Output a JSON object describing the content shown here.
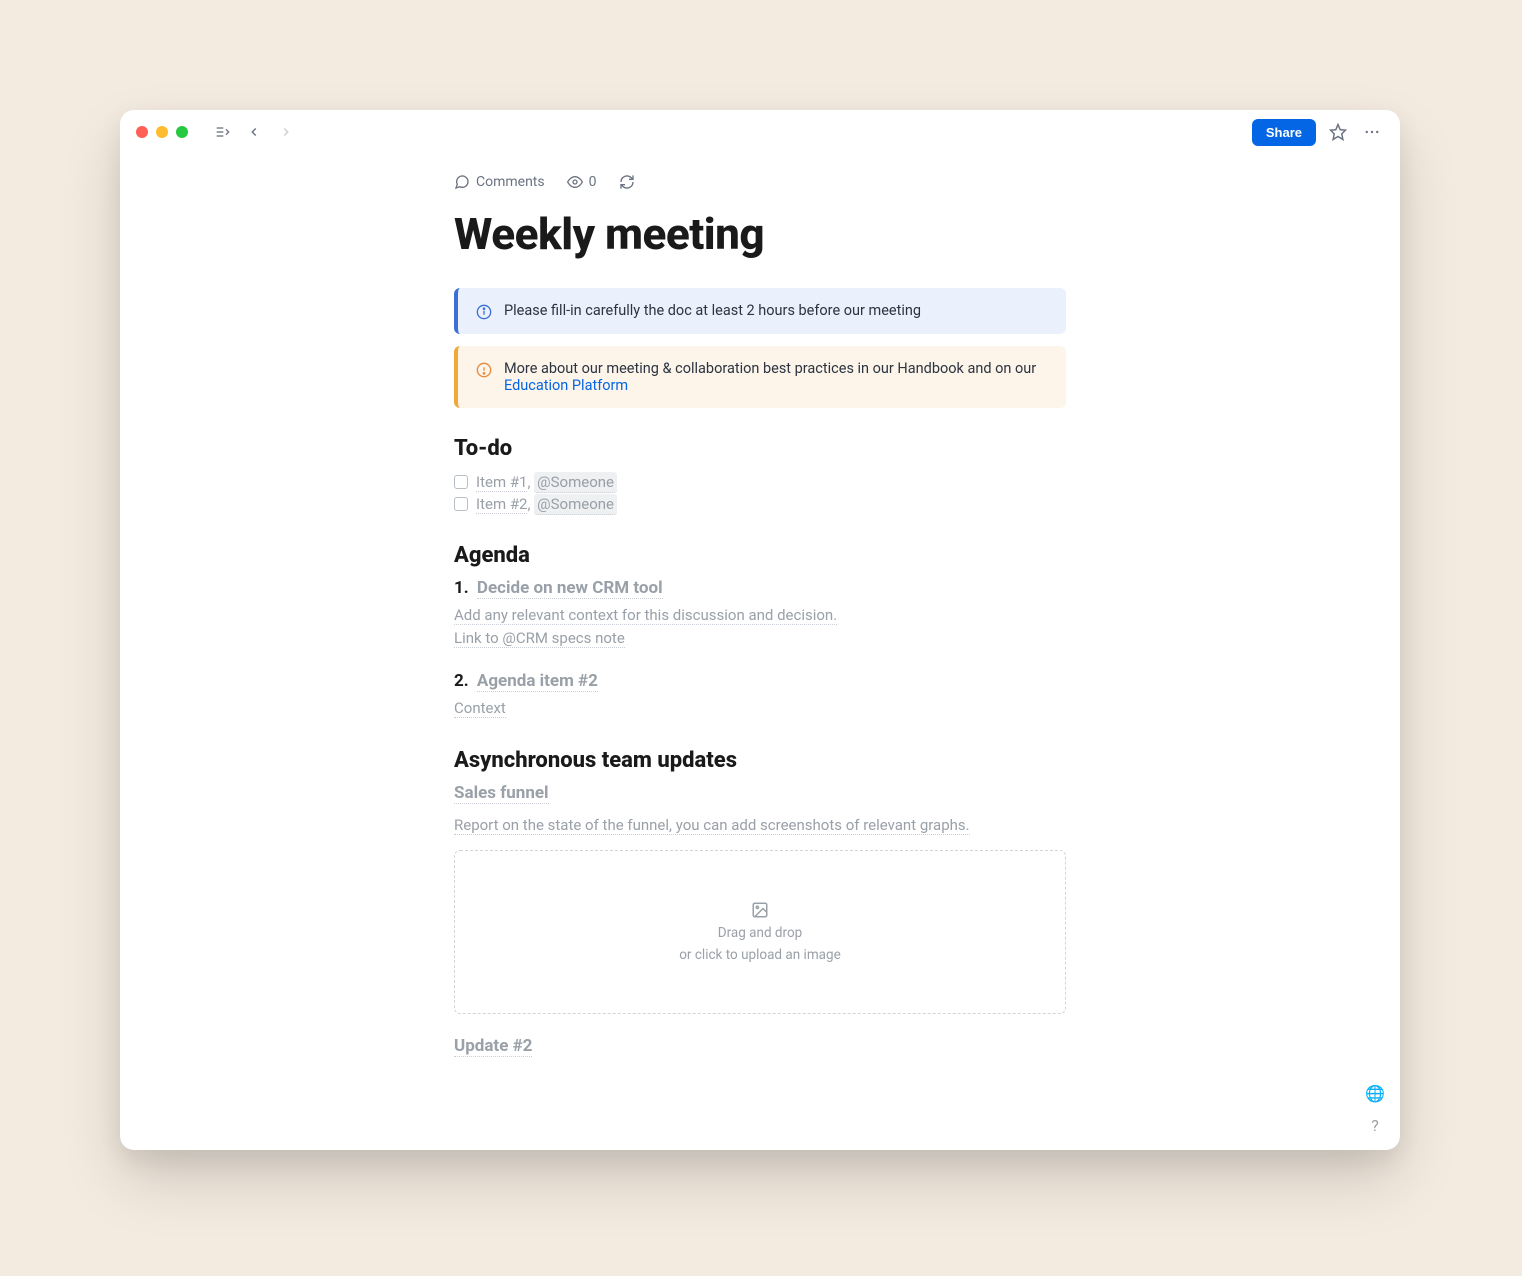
{
  "toolbar": {
    "share_label": "Share"
  },
  "meta": {
    "comments_label": "Comments",
    "views_count": "0"
  },
  "page": {
    "title": "Weekly meeting"
  },
  "callouts": {
    "blue": "Please fill-in carefully the doc at least 2 hours before our meeting",
    "orange_prefix": "More about our meeting & collaboration best practices in our Handbook and on our ",
    "orange_link": "Education Platform"
  },
  "sections": {
    "todo": "To-do",
    "agenda": "Agenda",
    "async": "Asynchronous team updates"
  },
  "todo": [
    {
      "text": "Item #1",
      "mention": "@Someone"
    },
    {
      "text": "Item #2",
      "mention": "@Someone"
    }
  ],
  "agenda": [
    {
      "num": "1.",
      "title": "Decide on new CRM tool",
      "body_line1": "Add any relevant context for this discussion and decision.",
      "body_line2": "Link to @CRM specs note"
    },
    {
      "num": "2.",
      "title": "Agenda item #2",
      "body_line1": "Context",
      "body_line2": ""
    }
  ],
  "updates": [
    {
      "title": "Sales funnel",
      "body": "Report on the state of the funnel, you can add screenshots of relevant graphs."
    },
    {
      "title": "Update #2",
      "body": ""
    }
  ],
  "dropzone": {
    "line1": "Drag and drop",
    "line2": "or click to upload an image"
  }
}
